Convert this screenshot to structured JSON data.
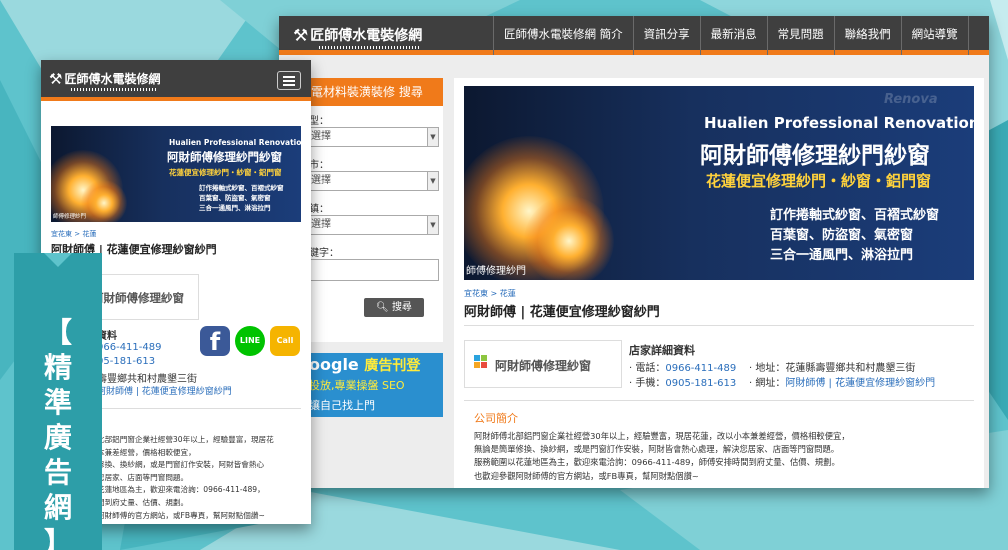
{
  "brand": {
    "logo_icon": "wrench-icon",
    "logo_text": "匠師傅水電裝修網"
  },
  "desktop": {
    "nav": [
      "匠師傅水電裝修網 簡介",
      "資訊分享",
      "最新消息",
      "常見問題",
      "聯絡我們",
      "網站導覽"
    ],
    "search": {
      "header": "電材料裝潢裝修 搜尋",
      "fields": [
        {
          "label": "型：",
          "value": "選擇"
        },
        {
          "label": "市：",
          "value": "選擇"
        },
        {
          "label": "鎮：",
          "value": "選擇"
        }
      ],
      "keyword_label": "鍵字：",
      "button": "搜尋"
    },
    "ad": {
      "line1": "oogle",
      "line1_accent": "廣告刊登",
      "line2": "投放,專業操盤 SEO",
      "line3": "讓自己找上門"
    }
  },
  "banner": {
    "en": "Hualien Professional Renovation",
    "title": "阿財師傅修理紗門紗窗",
    "sub": "花蓮便宜修理紗門・紗窗・鋁門窗",
    "lines": [
      "訂作捲軸式紗窗、百褶式紗窗",
      "百葉窗、防盜窗、氣密窗",
      "三合一通風門、淋浴拉門"
    ],
    "watermark": "師傅修理紗門",
    "corner": "Renova"
  },
  "listing": {
    "breadcrumb": "宜花東 > 花蓮",
    "title": "阿財師傅 | 花蓮便宜修理紗窗紗門",
    "store_name": "阿財師傅修理紗窗",
    "contact_heading": "店家詳細資料",
    "phone_label": "電話：",
    "phone": "0966-411-489",
    "mobile_label": "手機：",
    "mobile": "0905-181-613",
    "address_label": "地址：",
    "address": "花蓮縣壽豐鄉共和村農墾三街",
    "website_label": "網址：",
    "website": "阿財師傅 | 花蓮便宜修理紗窗紗門",
    "about_heading": "公司簡介",
    "about_desktop": [
      "阿財師傅北部鋁門窗企業社經營30年以上，經驗豐富，現居花蓮，改以小本兼差經營，價格相較便宜，",
      "無論是簡單修換、換紗網，或是門窗訂作安裝，阿財皆會熱心處理，解決您居家、店面等門窗問題。",
      "服務範圍以花蓮地區為主，歡迎來電洽詢：0966-411-489，師傅安排時間到府丈量、估價、規劃。",
      "也歡迎參觀阿財師傅的官方網站，或FB專頁，幫阿財點個讚~"
    ],
    "about_mobile": [
      "北部鋁門窗企業社經營30年以上，經驗豐富，現居花",
      "本兼差經營，價格相較便宜，",
      "修換、換紗網，或是門窗訂作安裝，阿財皆會熱心",
      "您居家、店面等門窗問題。",
      "花蓮地區為主，歡迎來電洽詢：0966-411-489，",
      "間到府丈量、估價、規劃。",
      "阿財師傅的官方網站，或FB專頁，幫阿財點個讚~"
    ]
  },
  "mobile": {
    "contact_heading": "資料",
    "phone": "966-411-489",
    "mobile": "05-181-613",
    "address": "壽豐鄉共和村農墾三街",
    "website": "阿財師傅 | 花蓮便宜修理紗窗紗門",
    "social": [
      {
        "name": "facebook-icon",
        "glyph": "f",
        "color": "#3b5998"
      },
      {
        "name": "line-icon",
        "glyph": "LINE",
        "color": "#00c300"
      },
      {
        "name": "call-icon",
        "glyph": "Call",
        "color": "#f5b400"
      }
    ]
  },
  "ribbon": {
    "chars": [
      "【",
      "精",
      "準",
      "廣",
      "告",
      "網",
      "】"
    ],
    "color": "#2d9ea8"
  },
  "colors": {
    "accent": "#f07a1a",
    "nav_bg": "#3f3f3f",
    "link": "#2a6ebb",
    "background": "#5ec3cc"
  }
}
